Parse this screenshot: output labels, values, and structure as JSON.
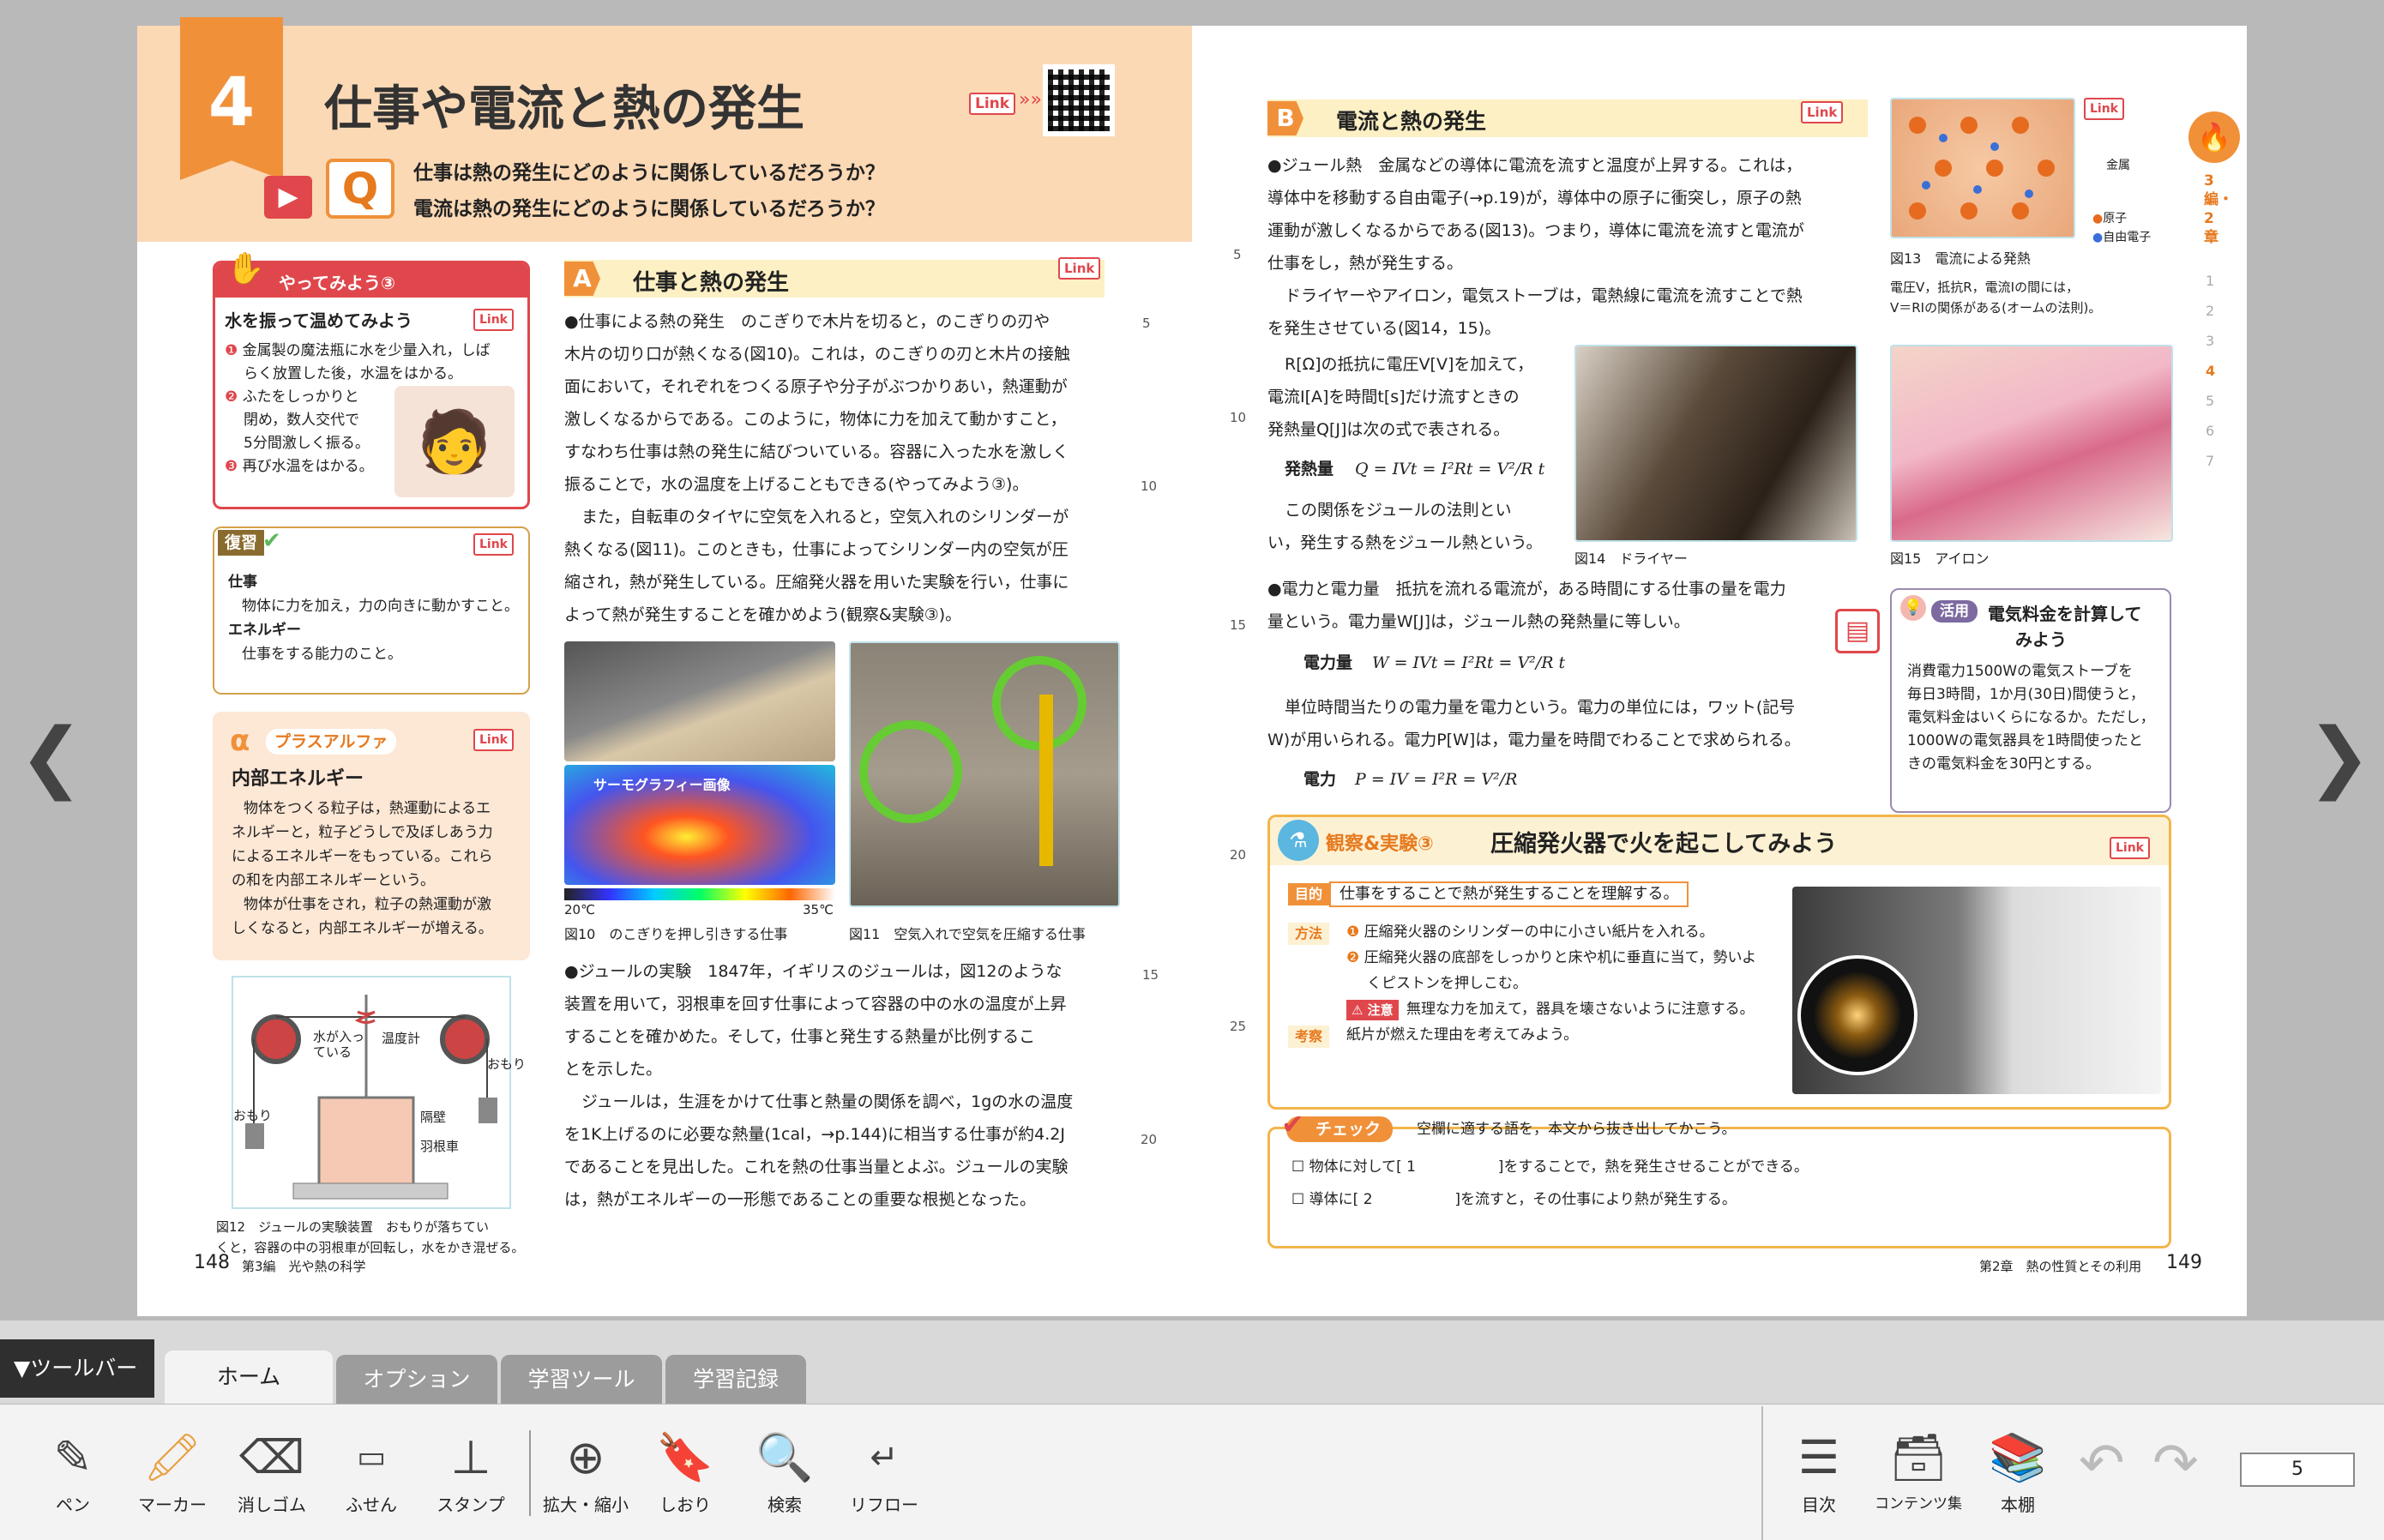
{
  "left": {
    "chapter_num": "4",
    "title": "仕事や電流と熱の発生",
    "q_mark": "Q",
    "q1": "仕事は熱の発生にどのように関係しているだろうか？",
    "q2": "電流は熱の発生にどのように関係しているだろうか？",
    "link": "Link",
    "yattemiyo_title": "やってみよう③",
    "yattemiyo_head": "水を振って温めてみよう",
    "yattemiyo_steps": [
      "金属製の魔法瓶に水を少量入れ，しば",
      "らく放置した後，水温をはかる。",
      "ふたをしっかりと",
      "閉め，数人交代で",
      "5分間激しく振る。",
      "再び水温をはかる。"
    ],
    "fukushu_title": "復習",
    "fukushu_lines": [
      "仕事",
      "物体に力を加え，力の向きに動かすこと。",
      "エネルギー",
      "仕事をする能力のこと。"
    ],
    "plus_title": "プラスアルファ",
    "plus_head": "内部エネルギー",
    "plus_lines": [
      "物体をつくる粒子は，熱運動によるエ",
      "ネルギーと，粒子どうしで及ぼしあう力",
      "によるエネルギーをもっている。これら",
      "の和を内部エネルギーという。",
      "物体が仕事をされ，粒子の熱運動が激",
      "しくなると，内部エネルギーが増える。"
    ],
    "fig12_labels": [
      "水が入っている",
      "温度計",
      "隔壁",
      "羽根車",
      "おもり",
      "おもり"
    ],
    "fig12_cap": [
      "図12　ジュールの実験装置　おもりが落ちてい",
      "くと，容器の中の羽根車が回転し，水をかき混ぜる。"
    ],
    "secA_mark": "A",
    "secA_title": "仕事と熱の発生",
    "secA_lines": [
      "●仕事による熱の発生　のこぎりで木片を切ると，のこぎりの刃や",
      "木片の切り口が熱くなる(図10)。これは，のこぎりの刃と木片の接触",
      "面において，それぞれをつくる原子や分子がぶつかりあい，熱運動が",
      "激しくなるからである。このように，物体に力を加えて動かすこと，",
      "すなわち仕事は熱の発生に結びついている。容器に入った水を激しく",
      "振ることで，水の温度を上げることもできる(やってみよう③)。",
      "また，自転車のタイヤに空気を入れると，空気入れのシリンダーが",
      "熱くなる(図11)。このときも，仕事によってシリンダー内の空気が圧",
      "縮され，熱が発生している。圧縮発火器を用いた実験を行い，仕事に",
      "よって熱が発生することを確かめよう(観察&実験③)。"
    ],
    "thermo_label": "サーモグラフィー画像",
    "thermo_min": "20℃",
    "thermo_max": "35℃",
    "fig10_cap": "図10　のこぎりを押し引きする仕事",
    "fig11_cap": "図11　空気入れで空気を圧縮する仕事",
    "joule_lines": [
      "●ジュールの実験　1847年，イギリスのジュールは，図12のような",
      "装置を用いて，羽根車を回す仕事によって容器の中の水の温度が上昇",
      "することを確かめた。そして，仕事と発生する熱量が比例するこ",
      "とを示した。",
      "ジュールは，生涯をかけて仕事と熱量の関係を調べ，1gの水の温度",
      "を1K上げるのに必要な熱量(1cal，→p.144)に相当する仕事が約4.2J",
      "であることを見出した。これを熱の仕事当量とよぶ。ジュールの実験",
      "は，熱がエネルギーの一形態であることの重要な根拠となった。"
    ],
    "line_nums": [
      "5",
      "10",
      "15",
      "20"
    ],
    "page_num": "148",
    "footer": "第3編　光や熱の科学"
  },
  "right": {
    "secB_mark": "B",
    "secB_title": "電流と熱の発生",
    "secB_lines": [
      "●ジュール熱　金属などの導体に電流を流すと温度が上昇する。これは，",
      "導体中を移動する自由電子(→p.19)が，導体中の原子に衝突し，原子の熱",
      "運動が激しくなるからである(図13)。つまり，導体に電流を流すと電流が",
      "仕事をし，熱が発生する。",
      "ドライヤーやアイロン，電気ストーブは，電熱線に電流を流すことで熱",
      "を発生させている(図14，15)。"
    ],
    "formula_lines": [
      "R[Ω]の抵抗に電圧V[V]を加えて，",
      "電流I[A]を時間t[s]だけ流すときの",
      "発熱量Q[J]は次の式で表される。"
    ],
    "f1_label": "発熱量",
    "f1": "Q = IVt = I²Rt = V²/R t",
    "joule_law_lines": [
      "この関係をジュールの法則とい",
      "い，発生する熱をジュール熱という。"
    ],
    "fig13_legend": [
      "金属",
      "原子",
      "自由電子"
    ],
    "fig13_cap": "図13　電流による発熱",
    "fig13_note": [
      "電圧V，抵抗R，電流Iの間には，",
      "V＝RIの関係がある(オームの法則)。"
    ],
    "fig14_cap": "図14　ドライヤー",
    "fig15_cap": "図15　アイロン",
    "power_lines": [
      "●電力と電力量　抵抗を流れる電流が，ある時間にする仕事の量を電力",
      "量という。電力量W[J]は，ジュール熱の発熱量に等しい。"
    ],
    "f2_label": "電力量",
    "f2": "W = IVt = I²Rt = V²/R t",
    "power2_lines": [
      "単位時間当たりの電力量を電力という。電力の単位には，ワット(記号",
      "W)が用いられる。電力P[W]は，電力量を時間でわることで求められる。"
    ],
    "f3_label": "電力",
    "f3": "P = IV = I²R = V²/R",
    "katsuyo_tag": "活用",
    "katsuyo_title": [
      "電気料金を計算して",
      "みよう"
    ],
    "katsuyo_lines": [
      "消費電力1500Wの電気ストーブを",
      "毎日3時間，1か月(30日)間使うと，",
      "電気料金はいくらになるか。ただし，",
      "1000Wの電気器具を1時間使ったと",
      "きの電気料金を30円とする。"
    ],
    "exp_tag": "観察&実験③",
    "exp_title": "圧縮発火器で火を起こしてみよう",
    "exp_goal_tag": "目的",
    "exp_goal": "仕事をすることで熱が発生することを理解する。",
    "exp_method_tag": "方法",
    "exp_steps": [
      "圧縮発火器のシリンダーの中に小さい紙片を入れる。",
      "圧縮発火器の底部をしっかりと床や机に垂直に当て，勢いよ",
      "くピストンを押しこむ。"
    ],
    "exp_caution_tag": "注意",
    "exp_caution": "無理な力を加えて，器具を壊さないように注意する。",
    "exp_think_tag": "考察",
    "exp_think": "紙片が燃えた理由を考えてみよう。",
    "check_tag": "チェック",
    "check_prompt": "空欄に適する語を，本文から抜き出してかこう。",
    "check_items": [
      "物体に対して[ 1 　　　　　 ]をすることで，熱を発生させることができる。",
      "導体に[ 2 　　　　　 ]を流すと，その仕事により熱が発生する。"
    ],
    "line_nums": [
      "5",
      "10",
      "15",
      "20",
      "25"
    ],
    "side_labels": [
      "3編・2章",
      "1",
      "2",
      "3",
      "4",
      "5",
      "6",
      "7"
    ],
    "page_num": "149",
    "footer": "第2章　熱の性質とその利用"
  },
  "toolbar": {
    "toggle": "▼ツールバー",
    "tabs": [
      "ホーム",
      "オプション",
      "学習ツール",
      "学習記録"
    ],
    "tools": [
      "ペン",
      "マーカー",
      "消しゴム",
      "ふせん",
      "スタンプ",
      "拡大・縮小",
      "しおり",
      "検索",
      "リフロー"
    ],
    "right_tools": [
      "目次",
      "コンテンツ集",
      "本棚"
    ],
    "page_input": "5",
    "nav_prev": "❮",
    "nav_next": "❯"
  }
}
